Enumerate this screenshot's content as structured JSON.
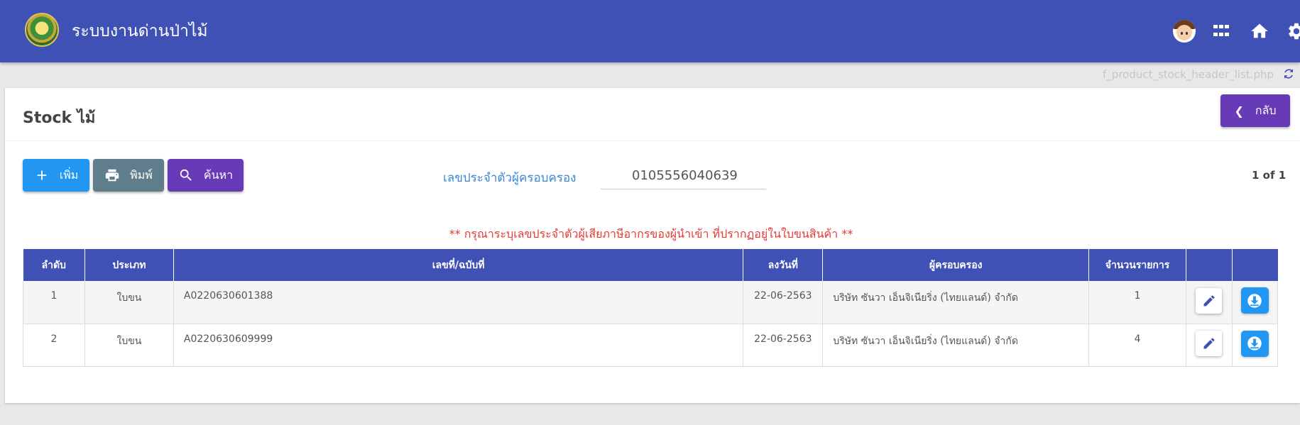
{
  "header": {
    "app_title": "ระบบงานด่านป่าไม้",
    "icons": [
      "menu-icon",
      "logo",
      "avatar",
      "apps-grid-icon",
      "home-icon",
      "gear-icon"
    ]
  },
  "page": {
    "filename": "f_product_stock_header_list.php",
    "title": "Stock ไม้",
    "back_label": "กลับ"
  },
  "toolbar": {
    "add_label": "เพิ่ม",
    "print_label": "พิมพ์",
    "search_label": "ค้นหา"
  },
  "filter": {
    "tax_id_label": "เลขประจำตัวผู้ครอบครอง",
    "tax_id_value": "0105556040639"
  },
  "pager": "1 of 1",
  "warning": "** กรุณาระบุเลขประจำตัวผู้เสียภาษีอากรของผู้นำเข้า ที่ปรากฏอยู่ในใบขนสินค้า **",
  "table": {
    "columns": [
      "ลำดับ",
      "ประเภท",
      "เลขที่/ฉบับที่",
      "ลงวันที่",
      "ผู้ครอบครอง",
      "จำนวนรายการ",
      "",
      ""
    ],
    "rows": [
      [
        "1",
        "ใบขน",
        "A0220630601388",
        "22-06-2563",
        "บริษัท ซันวา เอ็นจิเนียริ่ง (ไทยแลนด์) จำกัด",
        "1"
      ],
      [
        "2",
        "ใบขน",
        "A0220630609999",
        "22-06-2563",
        "บริษัท ซันวา เอ็นจิเนียริ่ง (ไทยแลนด์) จำกัด",
        "4"
      ]
    ]
  },
  "colors": {
    "header": "#3f51b5",
    "add": "#2196f3",
    "print": "#607d8b",
    "search": "#673ab7",
    "warning": "#e53935"
  }
}
